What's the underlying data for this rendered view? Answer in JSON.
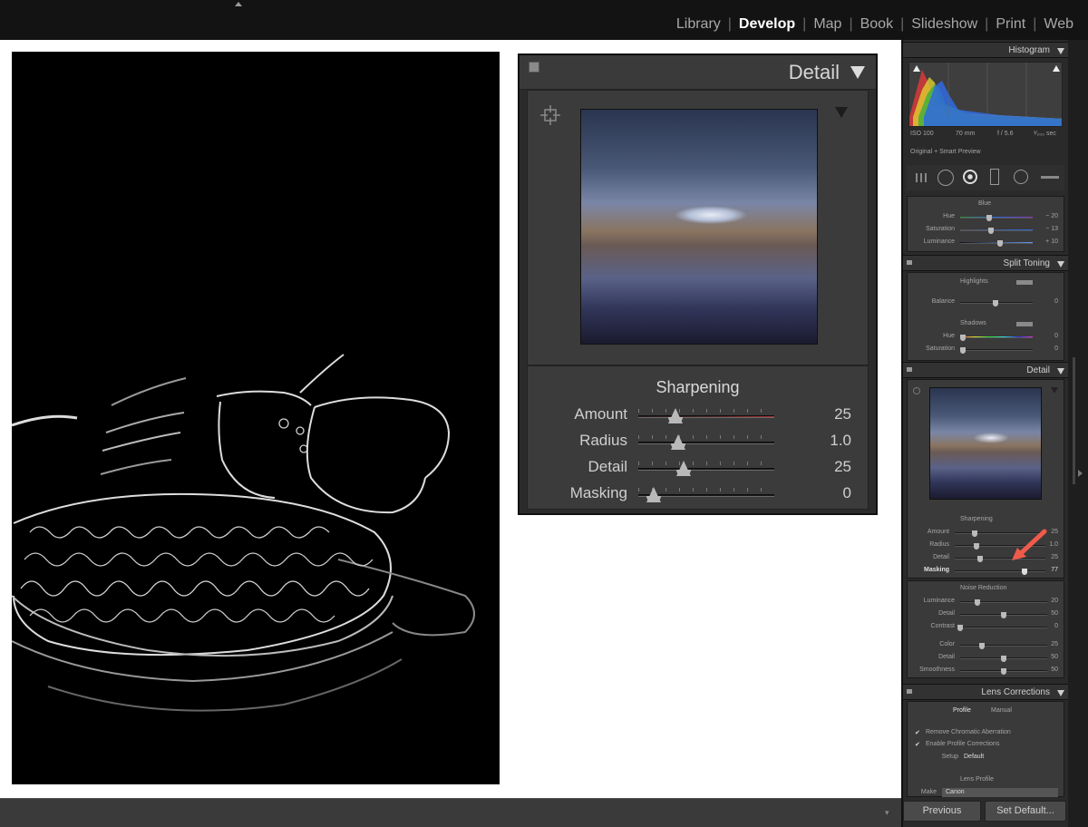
{
  "modules": {
    "items": [
      {
        "label": "Library",
        "active": false
      },
      {
        "label": "Develop",
        "active": true
      },
      {
        "label": "Map",
        "active": false
      },
      {
        "label": "Book",
        "active": false
      },
      {
        "label": "Slideshow",
        "active": false
      },
      {
        "label": "Print",
        "active": false
      },
      {
        "label": "Web",
        "active": false
      }
    ],
    "separator": "|"
  },
  "detail_zoom": {
    "title": "Detail",
    "section": "Sharpening",
    "sliders": [
      {
        "label": "Amount",
        "value": "25",
        "fraction": 0.22
      },
      {
        "label": "Radius",
        "value": "1.0",
        "fraction": 0.24
      },
      {
        "label": "Detail",
        "value": "25",
        "fraction": 0.28
      },
      {
        "label": "Masking",
        "value": "0",
        "fraction": 0.06
      }
    ]
  },
  "sidebar": {
    "histogram": {
      "title": "Histogram",
      "info": [
        "ISO 100",
        "70 mm",
        "f / 5.6",
        "¹⁄₂₀₀ sec"
      ],
      "preview_label": "Original + Smart Preview"
    },
    "hsl_blue": {
      "title": "Blue",
      "rows": [
        {
          "label": "Hue",
          "value": "− 20",
          "fraction": 0.4
        },
        {
          "label": "Saturation",
          "value": "− 13",
          "fraction": 0.43
        },
        {
          "label": "Luminance",
          "value": "+ 10",
          "fraction": 0.55
        }
      ]
    },
    "split_toning": {
      "title": "Split Toning",
      "highlights": "Highlights",
      "balance_label": "Balance",
      "balance_value": "0",
      "shadows": "Shadows",
      "rows": [
        {
          "label": "Hue",
          "value": "0"
        },
        {
          "label": "Saturation",
          "value": "0"
        }
      ]
    },
    "detail": {
      "title": "Detail",
      "sharpening": "Sharpening",
      "rows": [
        {
          "label": "Amount",
          "value": "25",
          "fraction": 0.22
        },
        {
          "label": "Radius",
          "value": "1.0",
          "fraction": 0.24
        },
        {
          "label": "Detail",
          "value": "25",
          "fraction": 0.28
        },
        {
          "label": "Masking",
          "value": "77",
          "fraction": 0.77
        }
      ],
      "noise_reduction": "Noise Reduction",
      "noise_rows": [
        {
          "label": "Luminance",
          "value": "20",
          "fraction": 0.2
        },
        {
          "label": "Detail",
          "value": "50",
          "fraction": 0.5
        },
        {
          "label": "Contrast",
          "value": "0",
          "fraction": 0.0
        },
        {
          "label": "Color",
          "value": "25",
          "fraction": 0.25
        },
        {
          "label": "Detail",
          "value": "50",
          "fraction": 0.5
        },
        {
          "label": "Smoothness",
          "value": "50",
          "fraction": 0.5
        }
      ]
    },
    "lens": {
      "title": "Lens Corrections",
      "tabs": [
        "Profile",
        "Manual"
      ],
      "checks": [
        "Remove Chromatic Aberration",
        "Enable Profile Corrections"
      ],
      "setup_label": "Setup",
      "setup_value": "Default",
      "profile_title": "Lens Profile",
      "make_label": "Make",
      "make_value": "Canon"
    },
    "buttons": {
      "previous": "Previous",
      "set_default": "Set Default..."
    }
  }
}
